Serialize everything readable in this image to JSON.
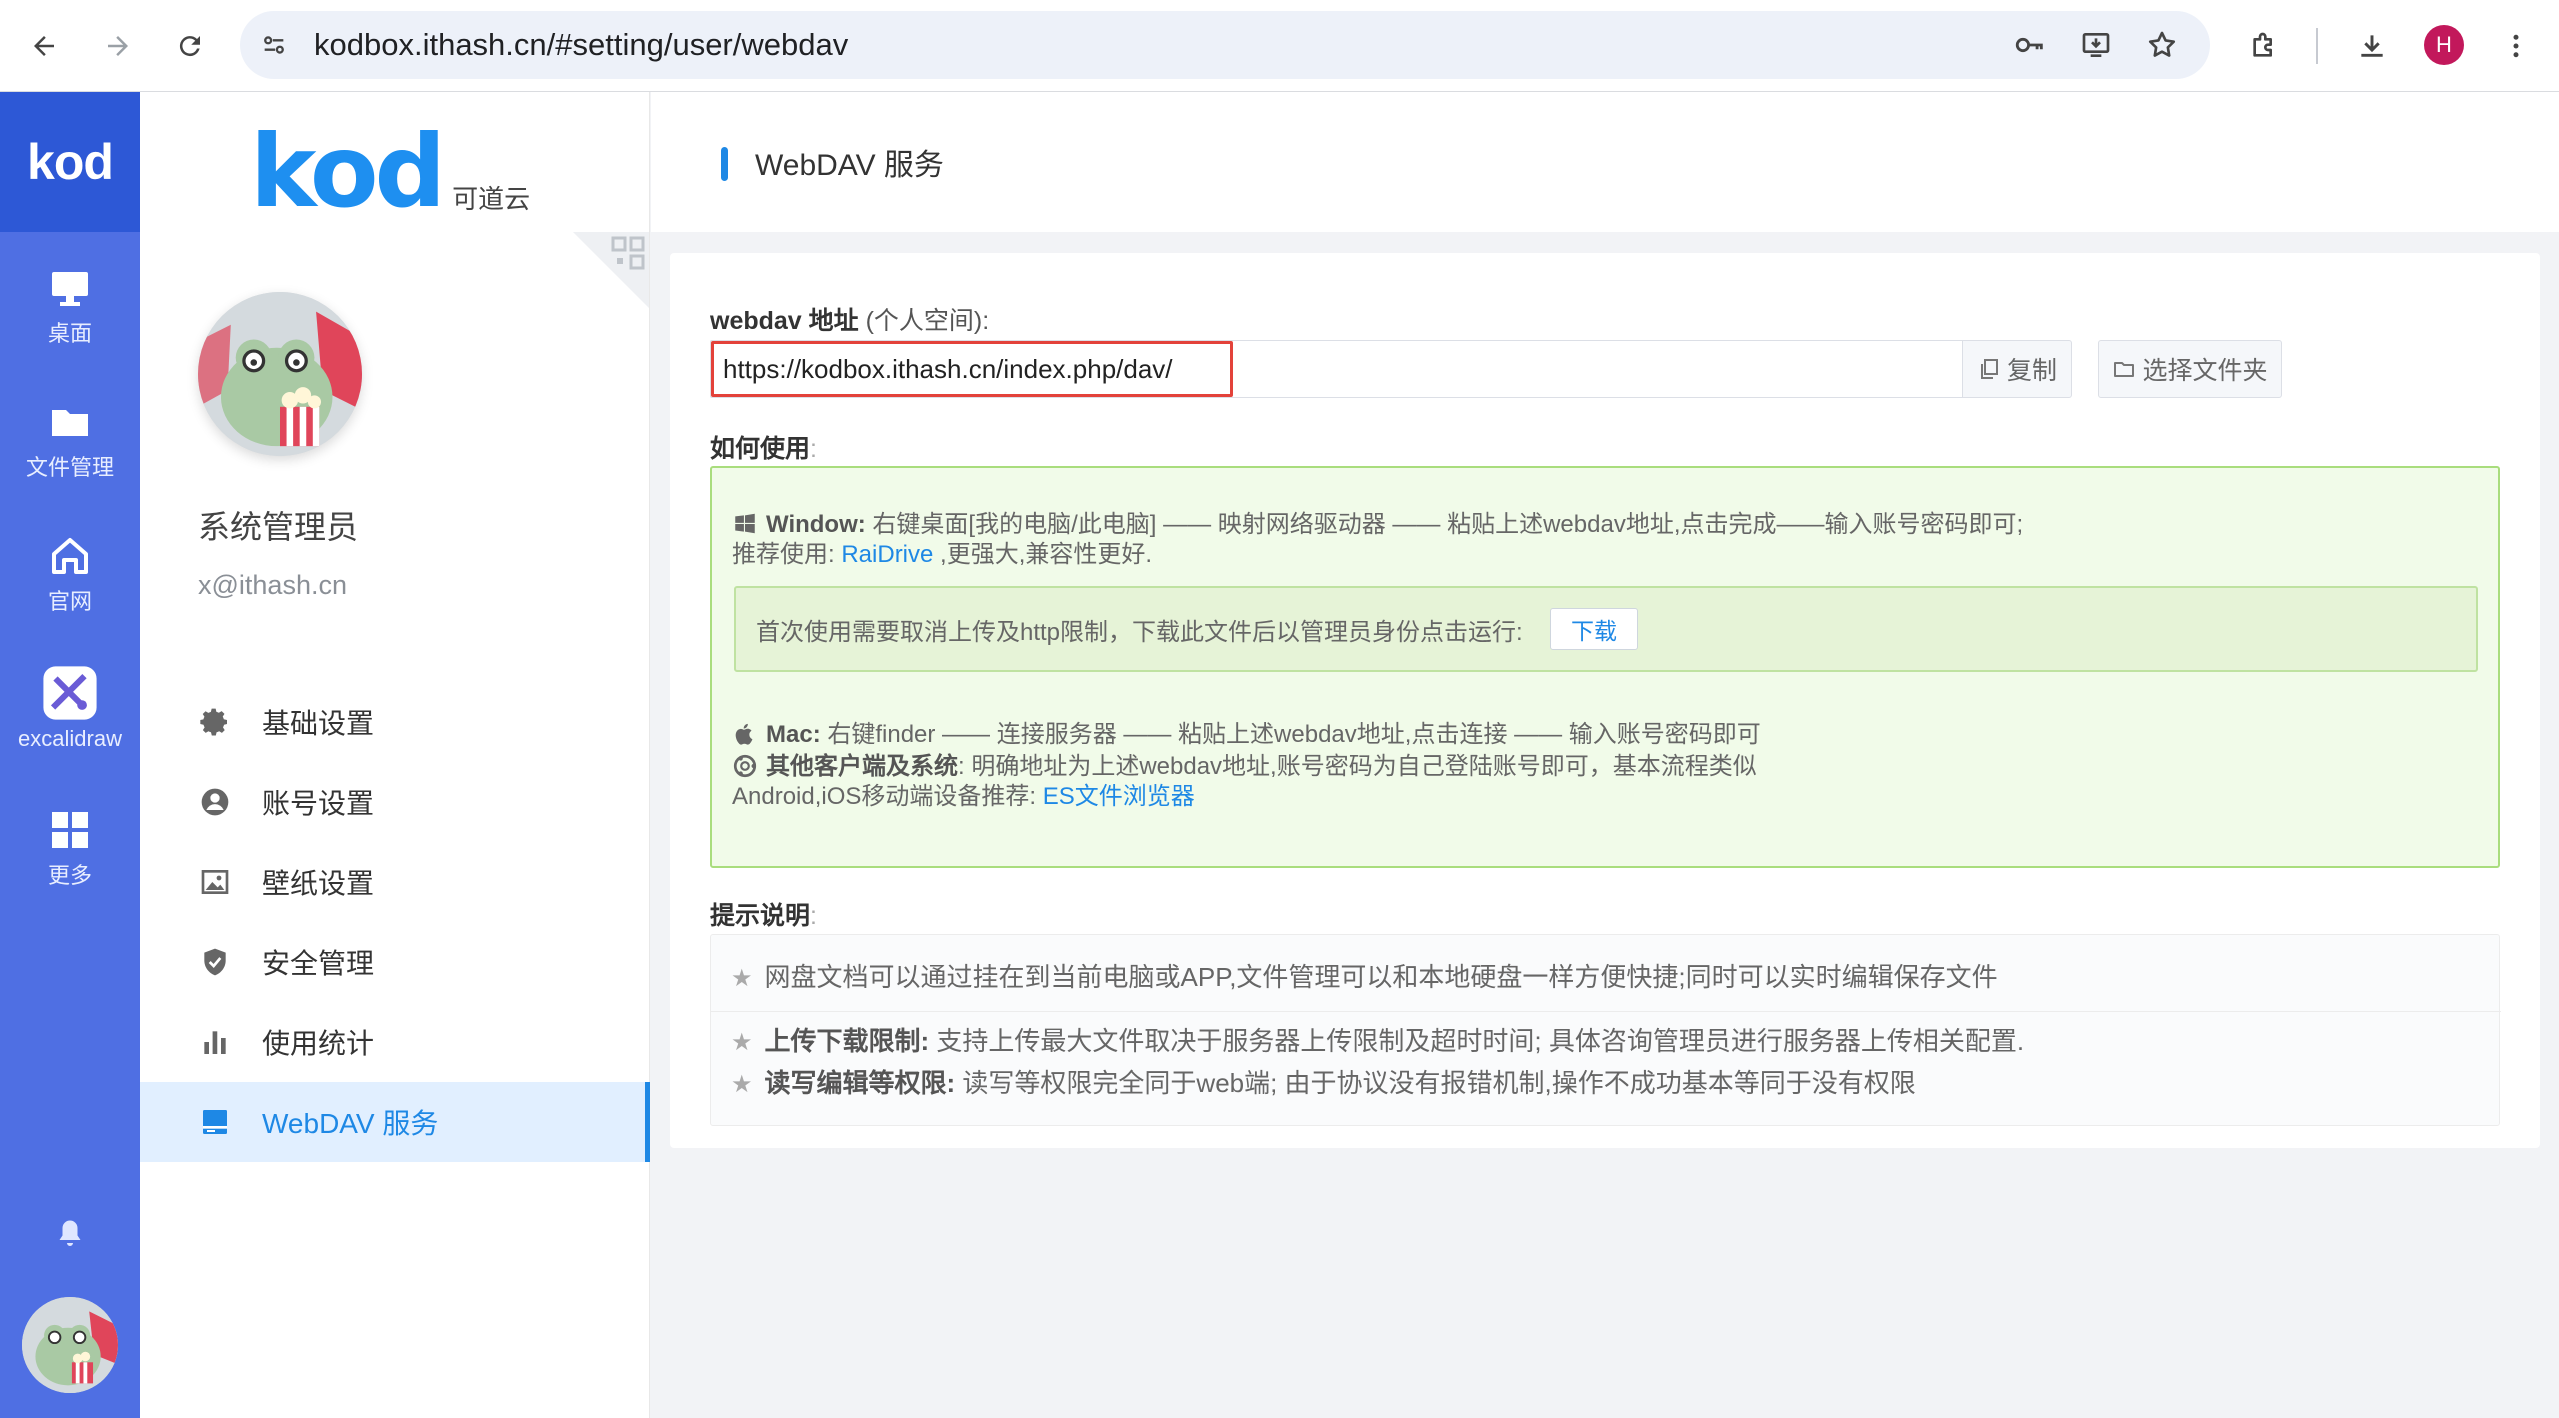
{
  "browser": {
    "url": "kodbox.ithash.cn/#setting/user/webdav",
    "profile_initial": "H"
  },
  "rail": {
    "logo": "kod",
    "items": [
      {
        "label": "桌面",
        "icon": "monitor-icon"
      },
      {
        "label": "文件管理",
        "icon": "folder-icon"
      },
      {
        "label": "官网",
        "icon": "home-icon"
      },
      {
        "label": "excalidraw",
        "icon": "excalidraw-icon"
      },
      {
        "label": "更多",
        "icon": "grid-icon"
      }
    ]
  },
  "sidebar": {
    "logo_big": "kod",
    "logo_small": "可道云",
    "user_name": "系统管理员",
    "user_email": "x@ithash.cn",
    "menu": [
      {
        "label": "基础设置",
        "icon": "gear-icon"
      },
      {
        "label": "账号设置",
        "icon": "user-circle-icon"
      },
      {
        "label": "壁纸设置",
        "icon": "image-icon"
      },
      {
        "label": "安全管理",
        "icon": "shield-icon"
      },
      {
        "label": "使用统计",
        "icon": "bar-chart-icon"
      },
      {
        "label": "WebDAV 服务",
        "icon": "drive-icon"
      }
    ]
  },
  "main": {
    "title": "WebDAV 服务",
    "address_label_bold": "webdav 地址",
    "address_label_rest": " (个人空间):",
    "address_value": "https://kodbox.ithash.cn/index.php/dav/",
    "copy_label": "复制",
    "select_folder_label": "选择文件夹",
    "howto_label": "如何使用",
    "howto_colon": ":",
    "windows_bold": "Window:",
    "windows_text": " 右键桌面[我的电脑/此电脑] —— 映射网络驱动器 —— 粘贴上述webdav地址,点击完成——输入账号密码即可;",
    "recommend_prefix": "推荐使用: ",
    "recommend_link": "RaiDrive",
    "recommend_suffix": " ,更强大,兼容性更好.",
    "notice_text": "首次使用需要取消上传及http限制，下载此文件后以管理员身份点击运行:",
    "download_label": "下载",
    "mac_bold": "Mac:",
    "mac_text": " 右键finder —— 连接服务器 —— 粘贴上述webdav地址,点击连接 —— 输入账号密码即可",
    "other_bold": "其他客户端及系统",
    "other_text": ": 明确地址为上述webdav地址,账号密码为自己登陆账号即可，基本流程类似",
    "android_prefix": "Android,iOS移动端设备推荐: ",
    "android_link": "ES文件浏览器",
    "tips_label": "提示说明",
    "tips_colon": ":",
    "tip1": "网盘文档可以通过挂在到当前电脑或APP,文件管理可以和本地硬盘一样方便快捷;同时可以实时编辑保存文件",
    "tip2_bold": "上传下载限制:",
    "tip2_text": " 支持上传最大文件取决于服务器上传限制及超时时间; 具体咨询管理员进行服务器上传相关配置.",
    "tip3_bold": "读写编辑等权限:",
    "tip3_text": " 读写等权限完全同于web端; 由于协议没有报错机制,操作不成功基本等同于没有权限"
  },
  "colors": {
    "rail_bg": "#4f6fe3",
    "accent": "#1e88e5",
    "howto_bg": "#f1fbe9",
    "howto_border": "#a9dd7d",
    "highlight_border": "#e3423a"
  }
}
